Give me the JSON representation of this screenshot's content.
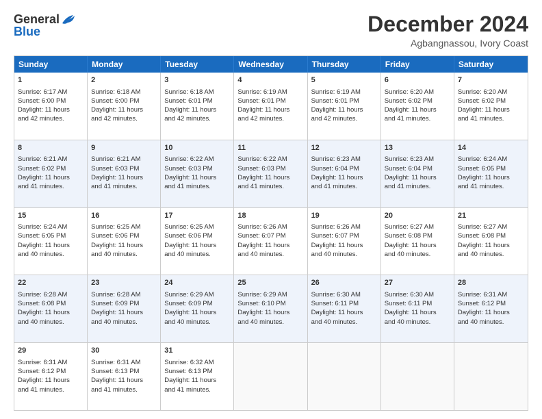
{
  "logo": {
    "general": "General",
    "blue": "Blue"
  },
  "title": "December 2024",
  "location": "Agbangnassou, Ivory Coast",
  "days_of_week": [
    "Sunday",
    "Monday",
    "Tuesday",
    "Wednesday",
    "Thursday",
    "Friday",
    "Saturday"
  ],
  "weeks": [
    [
      {
        "day": "1",
        "lines": [
          "Sunrise: 6:17 AM",
          "Sunset: 6:00 PM",
          "Daylight: 11 hours",
          "and 42 minutes."
        ]
      },
      {
        "day": "2",
        "lines": [
          "Sunrise: 6:18 AM",
          "Sunset: 6:00 PM",
          "Daylight: 11 hours",
          "and 42 minutes."
        ]
      },
      {
        "day": "3",
        "lines": [
          "Sunrise: 6:18 AM",
          "Sunset: 6:01 PM",
          "Daylight: 11 hours",
          "and 42 minutes."
        ]
      },
      {
        "day": "4",
        "lines": [
          "Sunrise: 6:19 AM",
          "Sunset: 6:01 PM",
          "Daylight: 11 hours",
          "and 42 minutes."
        ]
      },
      {
        "day": "5",
        "lines": [
          "Sunrise: 6:19 AM",
          "Sunset: 6:01 PM",
          "Daylight: 11 hours",
          "and 42 minutes."
        ]
      },
      {
        "day": "6",
        "lines": [
          "Sunrise: 6:20 AM",
          "Sunset: 6:02 PM",
          "Daylight: 11 hours",
          "and 41 minutes."
        ]
      },
      {
        "day": "7",
        "lines": [
          "Sunrise: 6:20 AM",
          "Sunset: 6:02 PM",
          "Daylight: 11 hours",
          "and 41 minutes."
        ]
      }
    ],
    [
      {
        "day": "8",
        "lines": [
          "Sunrise: 6:21 AM",
          "Sunset: 6:02 PM",
          "Daylight: 11 hours",
          "and 41 minutes."
        ]
      },
      {
        "day": "9",
        "lines": [
          "Sunrise: 6:21 AM",
          "Sunset: 6:03 PM",
          "Daylight: 11 hours",
          "and 41 minutes."
        ]
      },
      {
        "day": "10",
        "lines": [
          "Sunrise: 6:22 AM",
          "Sunset: 6:03 PM",
          "Daylight: 11 hours",
          "and 41 minutes."
        ]
      },
      {
        "day": "11",
        "lines": [
          "Sunrise: 6:22 AM",
          "Sunset: 6:03 PM",
          "Daylight: 11 hours",
          "and 41 minutes."
        ]
      },
      {
        "day": "12",
        "lines": [
          "Sunrise: 6:23 AM",
          "Sunset: 6:04 PM",
          "Daylight: 11 hours",
          "and 41 minutes."
        ]
      },
      {
        "day": "13",
        "lines": [
          "Sunrise: 6:23 AM",
          "Sunset: 6:04 PM",
          "Daylight: 11 hours",
          "and 41 minutes."
        ]
      },
      {
        "day": "14",
        "lines": [
          "Sunrise: 6:24 AM",
          "Sunset: 6:05 PM",
          "Daylight: 11 hours",
          "and 41 minutes."
        ]
      }
    ],
    [
      {
        "day": "15",
        "lines": [
          "Sunrise: 6:24 AM",
          "Sunset: 6:05 PM",
          "Daylight: 11 hours",
          "and 40 minutes."
        ]
      },
      {
        "day": "16",
        "lines": [
          "Sunrise: 6:25 AM",
          "Sunset: 6:06 PM",
          "Daylight: 11 hours",
          "and 40 minutes."
        ]
      },
      {
        "day": "17",
        "lines": [
          "Sunrise: 6:25 AM",
          "Sunset: 6:06 PM",
          "Daylight: 11 hours",
          "and 40 minutes."
        ]
      },
      {
        "day": "18",
        "lines": [
          "Sunrise: 6:26 AM",
          "Sunset: 6:07 PM",
          "Daylight: 11 hours",
          "and 40 minutes."
        ]
      },
      {
        "day": "19",
        "lines": [
          "Sunrise: 6:26 AM",
          "Sunset: 6:07 PM",
          "Daylight: 11 hours",
          "and 40 minutes."
        ]
      },
      {
        "day": "20",
        "lines": [
          "Sunrise: 6:27 AM",
          "Sunset: 6:08 PM",
          "Daylight: 11 hours",
          "and 40 minutes."
        ]
      },
      {
        "day": "21",
        "lines": [
          "Sunrise: 6:27 AM",
          "Sunset: 6:08 PM",
          "Daylight: 11 hours",
          "and 40 minutes."
        ]
      }
    ],
    [
      {
        "day": "22",
        "lines": [
          "Sunrise: 6:28 AM",
          "Sunset: 6:08 PM",
          "Daylight: 11 hours",
          "and 40 minutes."
        ]
      },
      {
        "day": "23",
        "lines": [
          "Sunrise: 6:28 AM",
          "Sunset: 6:09 PM",
          "Daylight: 11 hours",
          "and 40 minutes."
        ]
      },
      {
        "day": "24",
        "lines": [
          "Sunrise: 6:29 AM",
          "Sunset: 6:09 PM",
          "Daylight: 11 hours",
          "and 40 minutes."
        ]
      },
      {
        "day": "25",
        "lines": [
          "Sunrise: 6:29 AM",
          "Sunset: 6:10 PM",
          "Daylight: 11 hours",
          "and 40 minutes."
        ]
      },
      {
        "day": "26",
        "lines": [
          "Sunrise: 6:30 AM",
          "Sunset: 6:11 PM",
          "Daylight: 11 hours",
          "and 40 minutes."
        ]
      },
      {
        "day": "27",
        "lines": [
          "Sunrise: 6:30 AM",
          "Sunset: 6:11 PM",
          "Daylight: 11 hours",
          "and 40 minutes."
        ]
      },
      {
        "day": "28",
        "lines": [
          "Sunrise: 6:31 AM",
          "Sunset: 6:12 PM",
          "Daylight: 11 hours",
          "and 40 minutes."
        ]
      }
    ],
    [
      {
        "day": "29",
        "lines": [
          "Sunrise: 6:31 AM",
          "Sunset: 6:12 PM",
          "Daylight: 11 hours",
          "and 41 minutes."
        ]
      },
      {
        "day": "30",
        "lines": [
          "Sunrise: 6:31 AM",
          "Sunset: 6:13 PM",
          "Daylight: 11 hours",
          "and 41 minutes."
        ]
      },
      {
        "day": "31",
        "lines": [
          "Sunrise: 6:32 AM",
          "Sunset: 6:13 PM",
          "Daylight: 11 hours",
          "and 41 minutes."
        ]
      },
      {
        "day": "",
        "lines": []
      },
      {
        "day": "",
        "lines": []
      },
      {
        "day": "",
        "lines": []
      },
      {
        "day": "",
        "lines": []
      }
    ]
  ]
}
